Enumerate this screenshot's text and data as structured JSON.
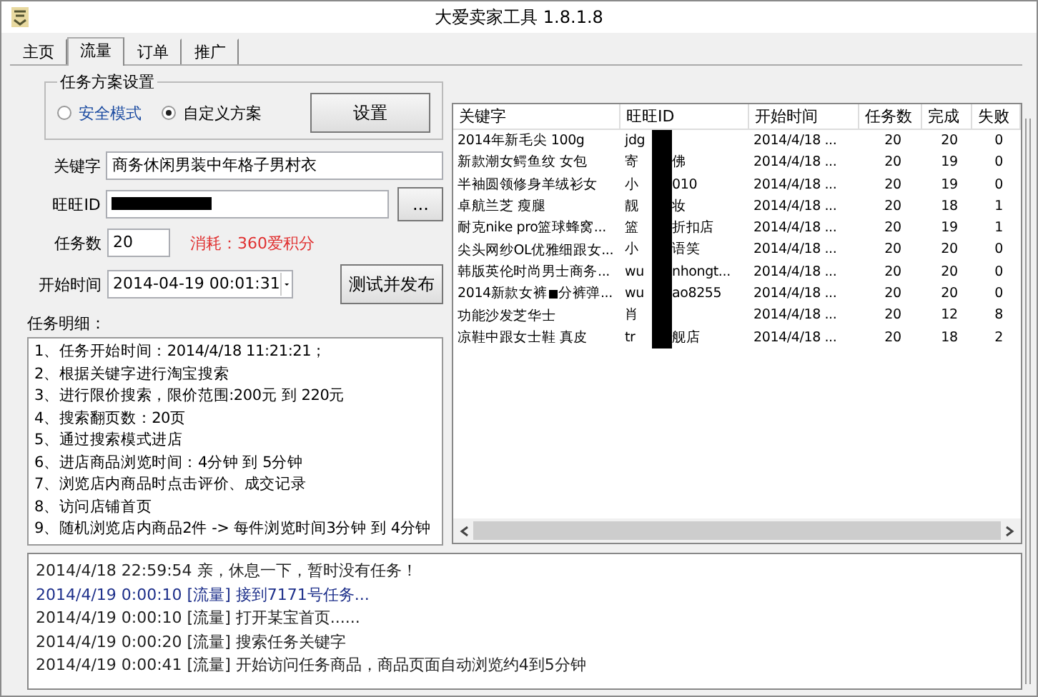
{
  "window": {
    "title": "大爱卖家工具 1.8.1.8"
  },
  "tabs": [
    {
      "label": "主页",
      "selected": false
    },
    {
      "label": "流量",
      "selected": true
    },
    {
      "label": "订单",
      "selected": false
    },
    {
      "label": "推广",
      "selected": false
    }
  ],
  "plan": {
    "title": "任务方案设置",
    "options": [
      {
        "label": "安全模式",
        "selected": false
      },
      {
        "label": "自定义方案",
        "selected": true
      }
    ],
    "button": "设置"
  },
  "form": {
    "keyword_label": "关键字",
    "keyword": "商务休闲男装中年格子男村衣",
    "id_label": "旺旺ID",
    "id_redacted": true,
    "browse_button": "...",
    "count_label": "任务数",
    "count": "20",
    "cost": "消耗：360爱积分",
    "time_label": "开始时间",
    "time": "2014-04-19 00:01:31",
    "publish_button": "测试并发布"
  },
  "details": {
    "label": "任务明细：",
    "lines": [
      "1、任务开始时间：2014/4/18 11:21:21；",
      "2、根据关键字进行淘宝搜索",
      "3、进行限价搜索，限价范围:200元 到 220元",
      "4、搜索翻页数：20页",
      "5、通过搜索模式进店",
      "6、进店商品浏览时间：4分钟 到 5分钟",
      "7、浏览店内商品时点击评价、成交记录",
      "8、访问店铺首页",
      "9、随机浏览店内商品2件 -> 每件浏览时间3分钟 到 4分钟"
    ]
  },
  "table": {
    "columns": [
      "关键字",
      "旺旺ID",
      "开始时间",
      "任务数",
      "完成",
      "失败"
    ],
    "rows": [
      {
        "keyword": " 2014年新毛尖 100g",
        "id_before": "jdg",
        "id_after": "",
        "start": "2014/4/18 ...",
        "tasks": "20",
        "done": "20",
        "failed": "0"
      },
      {
        "keyword": "新款潮女鳄鱼纹 女包",
        "id_before": "寄",
        "id_after": "佛",
        "start": "2014/4/18 ...",
        "tasks": "20",
        "done": "19",
        "failed": "0"
      },
      {
        "keyword": "半袖圆领修身羊绒衫女",
        "id_before": "小",
        "id_after": "010",
        "start": "2014/4/18 ...",
        "tasks": "20",
        "done": "19",
        "failed": "0"
      },
      {
        "keyword": "卓航兰芝 瘦腿",
        "id_before": "靓",
        "id_after": "妆",
        "start": "2014/4/18 ...",
        "tasks": "20",
        "done": "18",
        "failed": "1"
      },
      {
        "keyword": "耐克nike pro篮球蜂窝...",
        "id_before": "篮",
        "id_after": "折扣店",
        "start": "2014/4/18 ...",
        "tasks": "20",
        "done": "19",
        "failed": "1"
      },
      {
        "keyword": "尖头网纱OL优雅细跟女...",
        "id_before": "小",
        "id_after": "语笑",
        "start": "2014/4/18 ...",
        "tasks": "20",
        "done": "20",
        "failed": "0"
      },
      {
        "keyword": "韩版英伦时尚男士商务...",
        "id_before": "wu",
        "id_after": "nhongt...",
        "start": "2014/4/18 ...",
        "tasks": "20",
        "done": "20",
        "failed": "0"
      },
      {
        "keyword": "2014新款女裤",
        "keyword_after": "分裤弹...",
        "id_before": "wu",
        "id_after": "ao8255",
        "start": "2014/4/18 ...",
        "tasks": "20",
        "done": "20",
        "failed": "0"
      },
      {
        "keyword": "功能沙发芝华士",
        "id_before": "肖",
        "id_after": "",
        "start": "2014/4/18 ...",
        "tasks": "20",
        "done": "12",
        "failed": "8"
      },
      {
        "keyword": "凉鞋中跟女士鞋 真皮",
        "id_before": "tr",
        "id_after": "舰店",
        "start": "2014/4/18 ...",
        "tasks": "20",
        "done": "18",
        "failed": "2"
      }
    ]
  },
  "log": [
    {
      "text": "2014/4/18 22:59:54 亲，休息一下，暂时没有任务！",
      "kind": "normal"
    },
    {
      "text": "2014/4/19 0:00:10 [流量] 接到7171号任务...",
      "kind": "highlight"
    },
    {
      "text": "2014/4/19 0:00:10 [流量] 打开某宝首页......",
      "kind": "normal"
    },
    {
      "text": "2014/4/19 0:00:20 [流量] 搜索任务关键字",
      "kind": "normal"
    },
    {
      "text": "2014/4/19 0:00:41 [流量] 开始访问任务商品，商品页面自动浏览约4到5分钟",
      "kind": "normal"
    }
  ]
}
